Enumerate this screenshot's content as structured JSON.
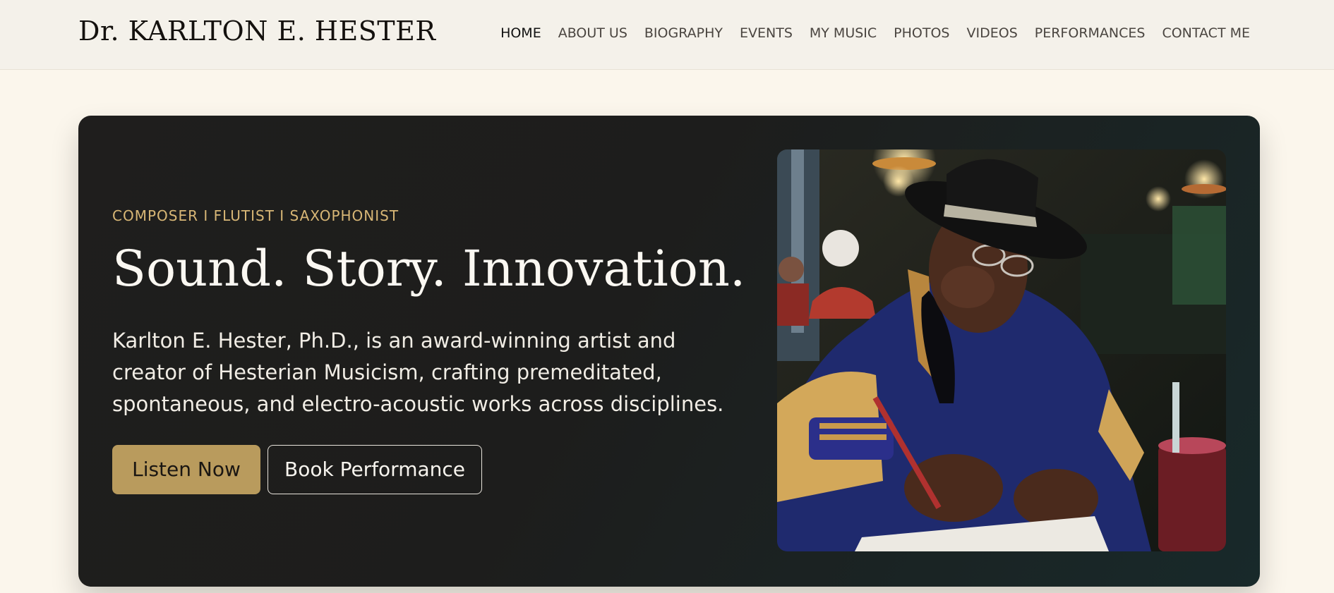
{
  "header": {
    "brand": "Dr. KARLTON E. HESTER",
    "nav": [
      "HOME",
      "ABOUT US",
      "BIOGRAPHY",
      "EVENTS",
      "MY MUSIC",
      "PHOTOS",
      "VIDEOS",
      "PERFORMANCES",
      "CONTACT ME"
    ],
    "active": "HOME"
  },
  "hero": {
    "eyebrow": "COMPOSER I FLUTIST I SAXOPHONIST",
    "headline": "Sound. Story. Innovation.",
    "lead": "Karlton E. Hester, Ph.D., is an award-winning artist and creator of Hesterian Musicism, crafting premeditated, spontaneous, and electro-acoustic works across disciplines.",
    "primary_button": "Listen Now",
    "secondary_button": "Book Performance"
  },
  "colors": {
    "accent_gold": "#b99b5d",
    "eyebrow_gold": "#d8b776",
    "hero_dark": "#1e1e1d",
    "page_bg": "#fbf6ec"
  }
}
